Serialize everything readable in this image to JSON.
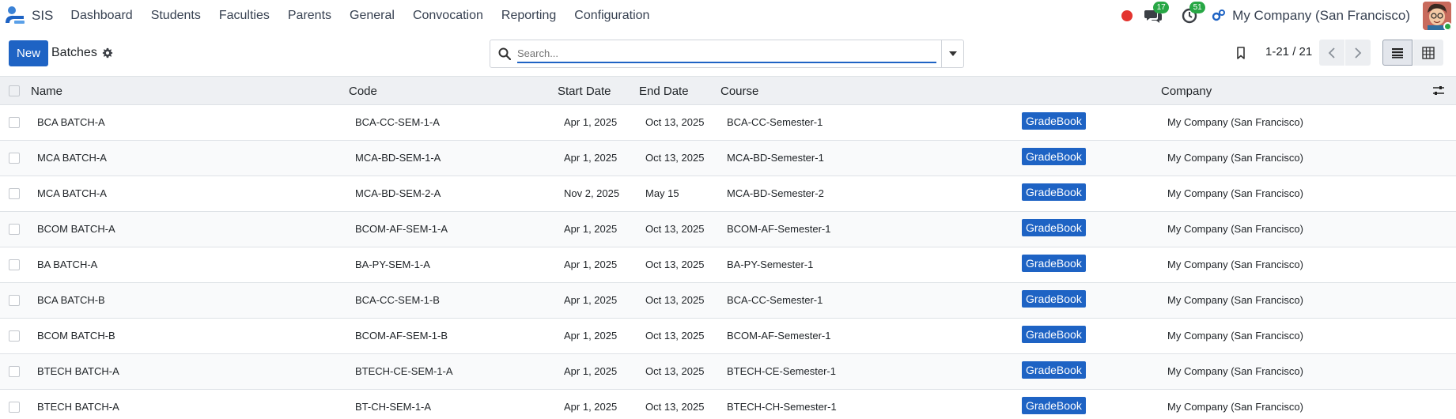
{
  "navbar": {
    "app_name": "SIS",
    "menu": [
      "Dashboard",
      "Students",
      "Faculties",
      "Parents",
      "General",
      "Convocation",
      "Reporting",
      "Configuration"
    ],
    "messages_count": "17",
    "activities_count": "51",
    "company": "My Company (San Francisco)"
  },
  "control": {
    "new_label": "New",
    "breadcrumb": "Batches",
    "search_placeholder": "Search...",
    "pager": "1-21 / 21"
  },
  "table": {
    "columns": {
      "name": "Name",
      "code": "Code",
      "start": "Start Date",
      "end": "End Date",
      "course": "Course",
      "company": "Company"
    },
    "rows": [
      {
        "name": "BCA BATCH-A",
        "code": "BCA-CC-SEM-1-A",
        "start": "Apr 1, 2025",
        "end": "Oct 13, 2025",
        "course": "BCA-CC-Semester-1",
        "gradebook": "GradeBook",
        "company": "My Company (San Francisco)"
      },
      {
        "name": "MCA BATCH-A",
        "code": "MCA-BD-SEM-1-A",
        "start": "Apr 1, 2025",
        "end": "Oct 13, 2025",
        "course": "MCA-BD-Semester-1",
        "gradebook": "GradeBook",
        "company": "My Company (San Francisco)"
      },
      {
        "name": "MCA BATCH-A",
        "code": "MCA-BD-SEM-2-A",
        "start": "Nov 2, 2025",
        "end": "May 15",
        "course": "MCA-BD-Semester-2",
        "gradebook": "GradeBook",
        "company": "My Company (San Francisco)"
      },
      {
        "name": "BCOM BATCH-A",
        "code": "BCOM-AF-SEM-1-A",
        "start": "Apr 1, 2025",
        "end": "Oct 13, 2025",
        "course": "BCOM-AF-Semester-1",
        "gradebook": "GradeBook",
        "company": "My Company (San Francisco)"
      },
      {
        "name": "BA BATCH-A",
        "code": "BA-PY-SEM-1-A",
        "start": "Apr 1, 2025",
        "end": "Oct 13, 2025",
        "course": "BA-PY-Semester-1",
        "gradebook": "GradeBook",
        "company": "My Company (San Francisco)"
      },
      {
        "name": "BCA BATCH-B",
        "code": "BCA-CC-SEM-1-B",
        "start": "Apr 1, 2025",
        "end": "Oct 13, 2025",
        "course": "BCA-CC-Semester-1",
        "gradebook": "GradeBook",
        "company": "My Company (San Francisco)"
      },
      {
        "name": "BCOM BATCH-B",
        "code": "BCOM-AF-SEM-1-B",
        "start": "Apr 1, 2025",
        "end": "Oct 13, 2025",
        "course": "BCOM-AF-Semester-1",
        "gradebook": "GradeBook",
        "company": "My Company (San Francisco)"
      },
      {
        "name": "BTECH BATCH-A",
        "code": "BTECH-CE-SEM-1-A",
        "start": "Apr 1, 2025",
        "end": "Oct 13, 2025",
        "course": "BTECH-CE-Semester-1",
        "gradebook": "GradeBook",
        "company": "My Company (San Francisco)"
      },
      {
        "name": "BTECH BATCH-A",
        "code": "BT-CH-SEM-1-A",
        "start": "Apr 1, 2025",
        "end": "Oct 13, 2025",
        "course": "BTECH-CH-Semester-1",
        "gradebook": "GradeBook",
        "company": "My Company (San Francisco)"
      }
    ]
  },
  "colors": {
    "primary": "#1e63c4",
    "badge": "#28a745",
    "recording": "#e3342f",
    "header_bg": "#eef0f3"
  },
  "icons": {
    "app": "sis-logo-icon",
    "settings": "gear-icon",
    "search": "search-icon",
    "favorite": "bookmark-icon",
    "list_view": "list-view-icon",
    "pivot_view": "pivot-view-icon",
    "optional_columns": "sliders-icon"
  }
}
